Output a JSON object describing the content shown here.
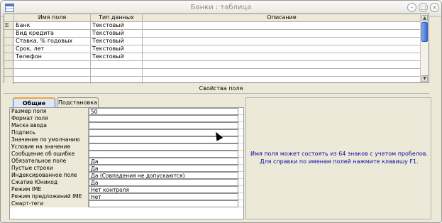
{
  "window": {
    "title": "Банки : таблица",
    "controls": {
      "minimize": "–",
      "maximize": "□",
      "close": "×"
    }
  },
  "design_grid": {
    "headers": {
      "field_name": "Имя поля",
      "data_type": "Тип данных",
      "description": "Описание"
    },
    "fields": [
      {
        "name": "Банк",
        "type": "Текстовый"
      },
      {
        "name": "Вид кредита",
        "type": "Текстовый"
      },
      {
        "name": "Ставка, % годовых",
        "type": "Текстовый"
      },
      {
        "name": "Срок, лет",
        "type": "Текстовый"
      },
      {
        "name": "Телефон",
        "type": "Текстовый"
      }
    ]
  },
  "properties": {
    "section_title": "Свойства поля",
    "tabs": [
      "Общие",
      "Подстановка"
    ],
    "rows": [
      {
        "label": "Размер поля",
        "value": "50"
      },
      {
        "label": "Формат поля",
        "value": ""
      },
      {
        "label": "Маска ввода",
        "value": ""
      },
      {
        "label": "Подпись",
        "value": ""
      },
      {
        "label": "Значение по умолчанию",
        "value": ""
      },
      {
        "label": "Условие на значение",
        "value": ""
      },
      {
        "label": "Сообщение об ошибке",
        "value": ""
      },
      {
        "label": "Обязательное поле",
        "value": "Да"
      },
      {
        "label": "Пустые строки",
        "value": "Да"
      },
      {
        "label": "Индексированное поле",
        "value": "Да (Совпадения не допускаются)"
      },
      {
        "label": "Сжатие Юникод",
        "value": "Да"
      },
      {
        "label": "Режим IME",
        "value": "Нет контроля"
      },
      {
        "label": "Режим предложений IME",
        "value": "Нет"
      },
      {
        "label": "Смарт-теги",
        "value": ""
      }
    ]
  },
  "help_text": "Имя поля может состоять из 64 знаков с учетом пробелов.  Для справки по именам полей нажмите клавишу F1."
}
